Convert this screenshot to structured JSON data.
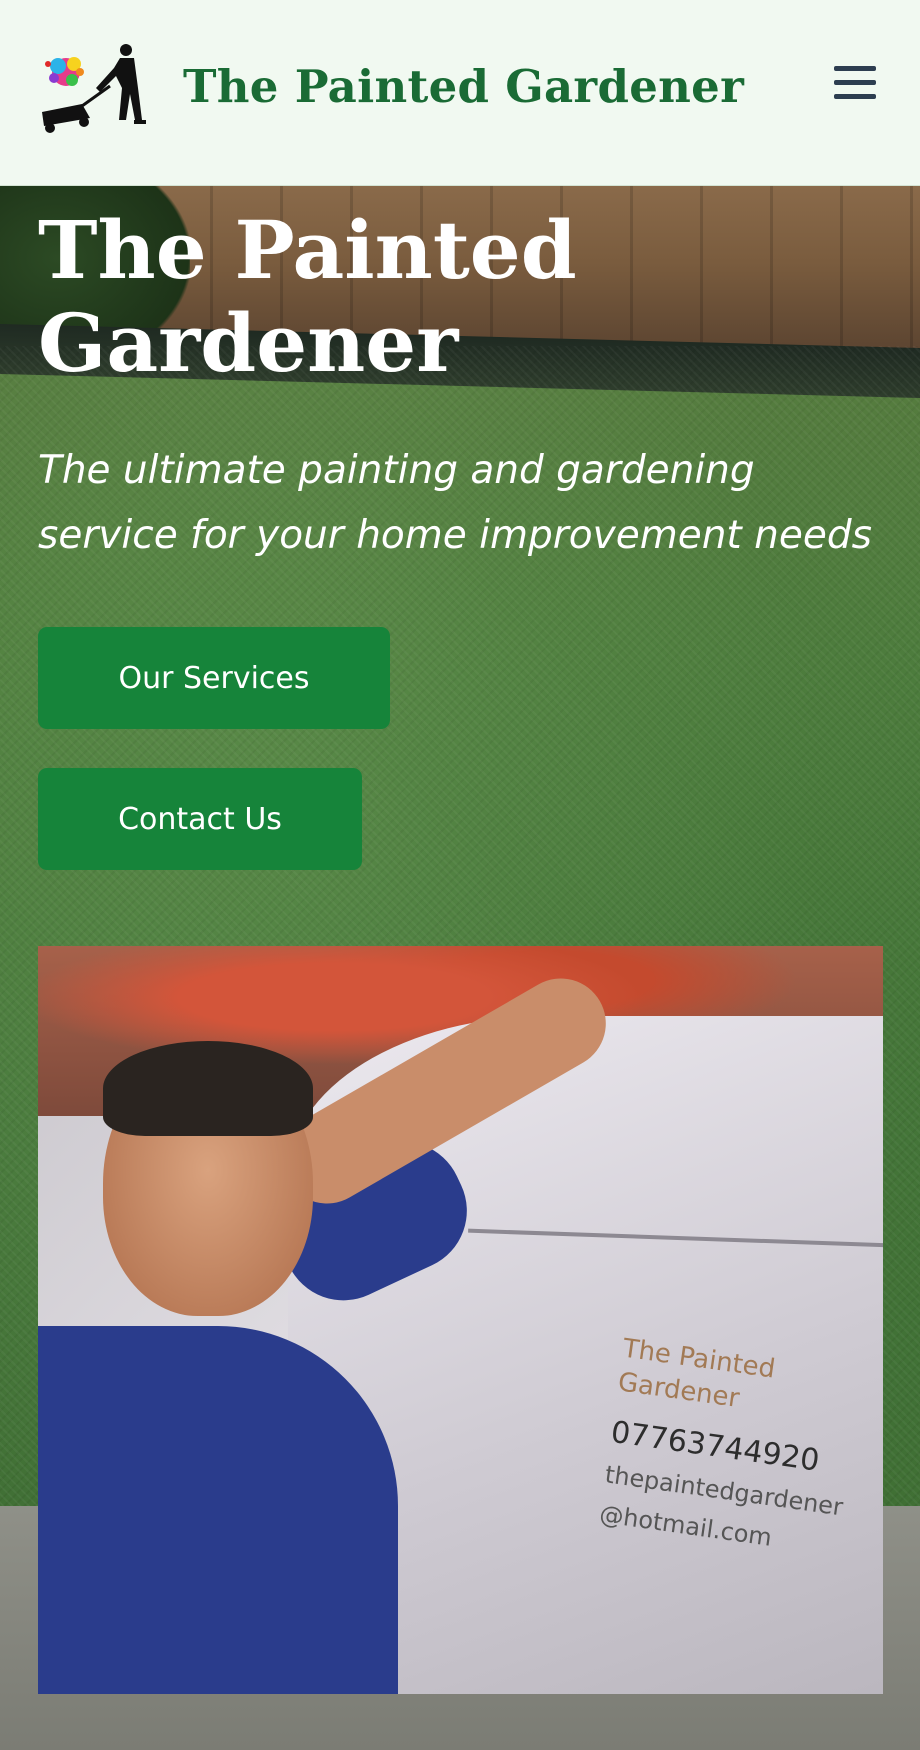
{
  "header": {
    "brand_name": "The Painted Gardener",
    "logo_icon": "painted-gardener-mower-logo",
    "menu_icon": "hamburger-menu-icon",
    "background": "#f1f9f1",
    "brand_color": "#1a6b35"
  },
  "hero": {
    "title_line1": "The Painted",
    "title_line2": "Gardener",
    "subtitle": "The ultimate painting and gardening service for your home improvement needs",
    "buttons": {
      "services_label": "Our Services",
      "contact_label": "Contact Us"
    },
    "button_color": "#16843a"
  },
  "photo": {
    "sign": {
      "name_line1": "The Painted",
      "name_line2": "Gardener",
      "phone": "07763744920",
      "email_line1": "thepaintedgardener",
      "email_line2": "@hotmail.com"
    }
  }
}
